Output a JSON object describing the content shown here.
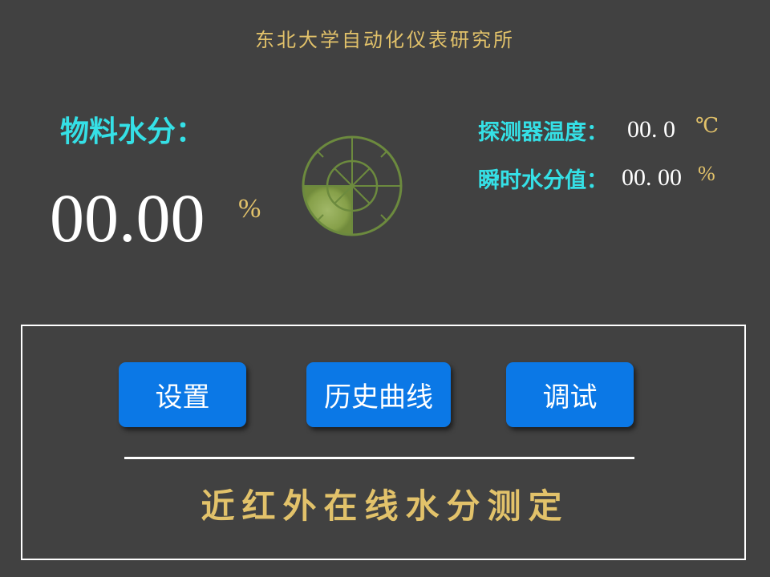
{
  "header": {
    "title": "东北大学自动化仪表研究所"
  },
  "material": {
    "label": "物料水分：",
    "value": "00.00",
    "unit": "%"
  },
  "gauge": {
    "icon": "radar-gauge-icon",
    "fill_color": "#8aa54a",
    "line_color": "#6c8a3e"
  },
  "detector": {
    "label": "探测器温度：",
    "value": "00. 0",
    "unit": "℃"
  },
  "instant": {
    "label": "瞬时水分值：",
    "value": "00. 00",
    "unit": "%"
  },
  "buttons": {
    "settings": "设置",
    "history": "历史曲线",
    "debug": "调试"
  },
  "footer": {
    "text": "近红外在线水分测定"
  },
  "colors": {
    "background": "#414141",
    "accent_cyan": "#35e0e6",
    "accent_gold": "#e2c26a",
    "button_blue": "#0b78e6"
  }
}
